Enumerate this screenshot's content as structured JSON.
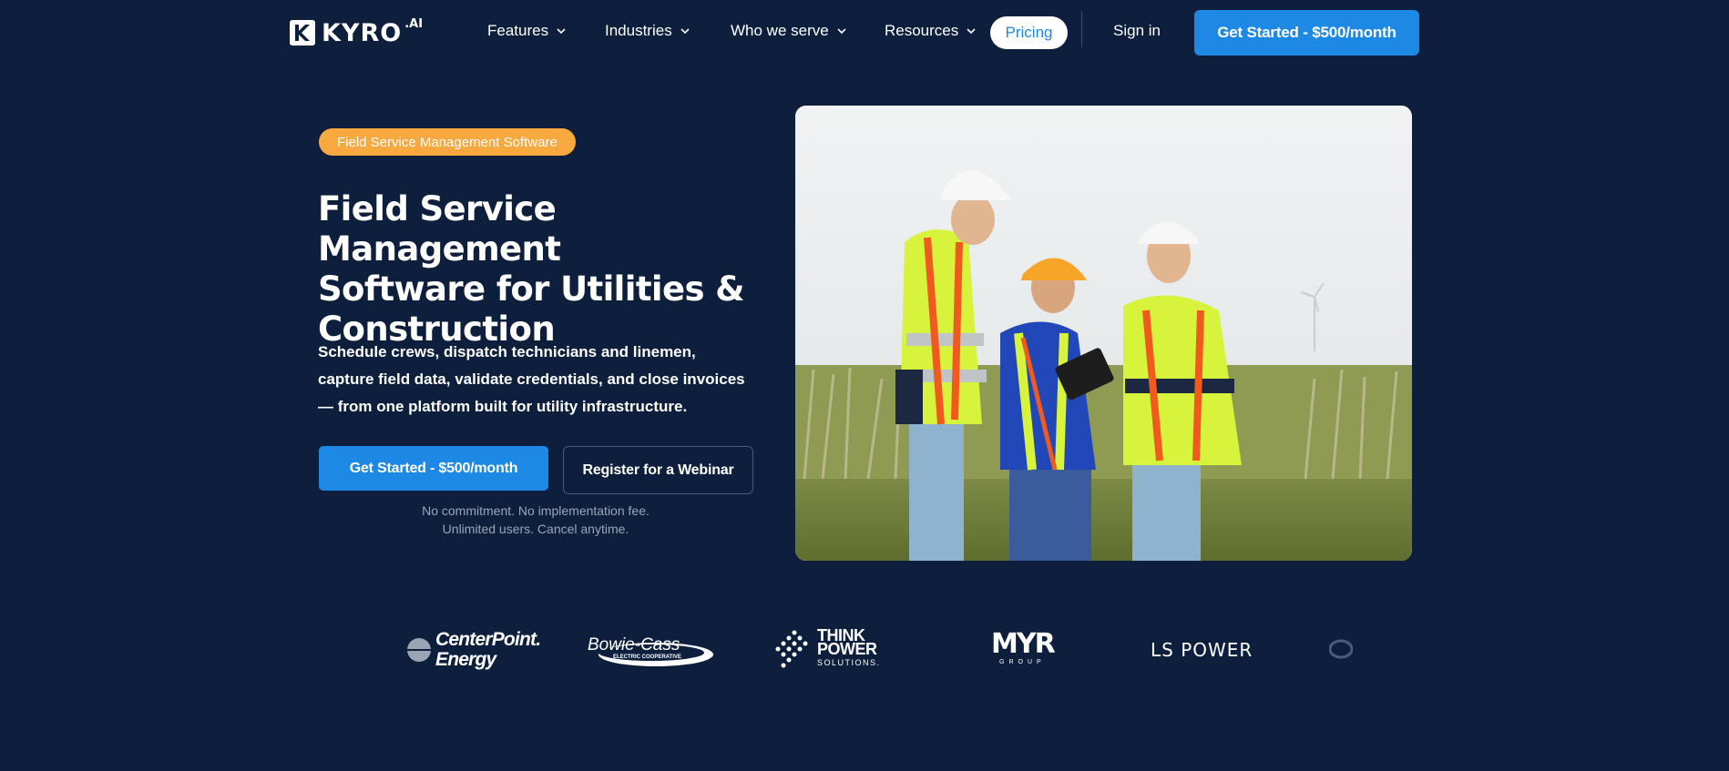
{
  "nav": {
    "logo_text": "KYRO",
    "logo_suffix": ".AI",
    "items": [
      {
        "label": "Features",
        "icon": "chevron-down-icon"
      },
      {
        "label": "Industries",
        "icon": "chevron-down-icon"
      },
      {
        "label": "Who we serve",
        "icon": "chevron-down-icon"
      },
      {
        "label": "Resources",
        "icon": "chevron-down-icon"
      }
    ],
    "pricing": "Pricing",
    "sign_in": "Sign in",
    "cta": "Get Started - $500/month"
  },
  "hero": {
    "badge": "Field Service Management Software",
    "title_line1": "Field Service Management",
    "title_line2": "Software for Utilities &",
    "title_line3": "Construction",
    "subtitle": "Schedule crews, dispatch technicians and linemen, capture field data, validate credentials, and close invoices — from one platform built for utility infrastructure.",
    "cta_primary": "Get Started - $500/month",
    "cta_secondary": "Register for a Webinar",
    "fineprint_line1": "No commitment. No implementation fee.",
    "fineprint_line2": "Unlimited users. Cancel anytime."
  },
  "clients": {
    "centerpoint_line1": "CenterPoint.",
    "centerpoint_line2": "Energy",
    "bowie_cass": "Bowie-Cass",
    "bowie_cass_sub": "ELECTRIC COOPERATIVE",
    "think_line1": "THINK",
    "think_line2": "POWER",
    "think_line3": "SOLUTIONS.",
    "myr": "MYR",
    "myr_sub": "GROUP",
    "ls_power": "LS POWER"
  },
  "colors": {
    "background": "#0d1f3c",
    "accent": "#1e88e5",
    "badge": "#f7a83e"
  }
}
